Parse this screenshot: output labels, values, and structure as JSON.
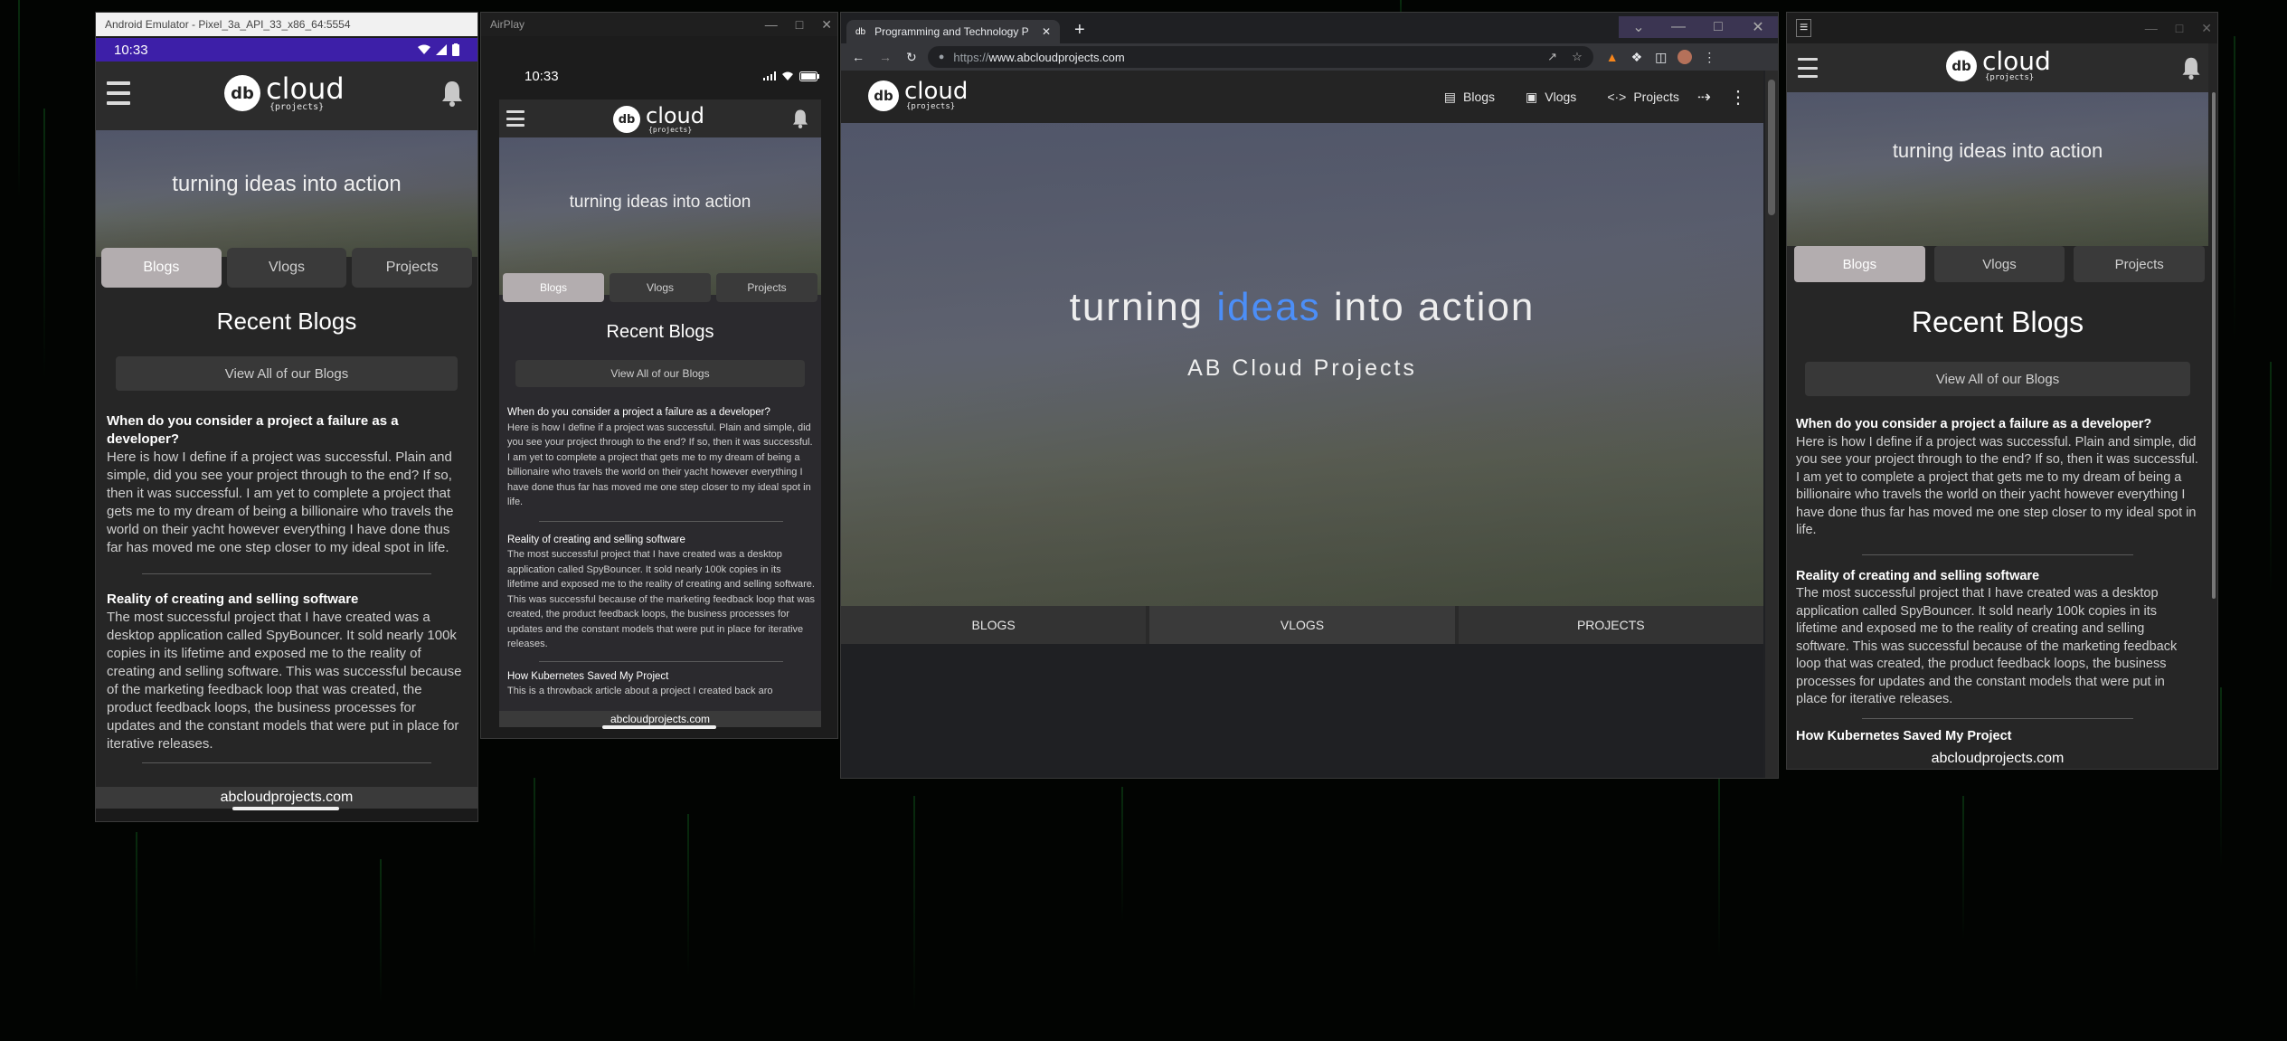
{
  "emulator": {
    "title": "Android Emulator - Pixel_3a_API_33_x86_64:5554",
    "time": "10:33"
  },
  "airplay": {
    "title": "AirPlay",
    "time": "10:33"
  },
  "browser": {
    "tab_title": "Programming and Technology P",
    "url_prefix": "https://",
    "url_host": "www.abcloudprojects.com",
    "nav": {
      "blogs": "Blogs",
      "vlogs": "Vlogs",
      "projects": "Projects"
    },
    "hero_word1": "turning",
    "hero_word2": "ideas",
    "hero_word3": "into action",
    "hero_sub": "AB Cloud Projects",
    "bottom_tabs": {
      "blogs": "BLOGS",
      "vlogs": "VLOGS",
      "projects": "PROJECTS"
    },
    "accent": "#4c8ef7"
  },
  "site": {
    "logo_badge": "db",
    "logo_big": "cloud",
    "logo_small": "{projects}",
    "tagline": "turning ideas into action",
    "tabs": {
      "blogs": "Blogs",
      "vlogs": "Vlogs",
      "projects": "Projects"
    },
    "section_title": "Recent Blogs",
    "view_all": "View All of our Blogs",
    "footer": "abcloudprojects.com",
    "posts": [
      {
        "title": "When do you consider a project a failure as a developer?",
        "body": "Here is how I define if a project was successful. Plain and simple, did you see your project through to the end?  If so, then it was successful.  I am yet to complete a project that gets me to my dream of being a billionaire who travels the world on their yacht however everything I have done thus far has moved me one step closer to my ideal spot in life."
      },
      {
        "title": "Reality of creating and selling software",
        "body": "The most successful project that I have created was a desktop application called SpyBouncer.  It sold nearly 100k copies in its lifetime and exposed me to the reality of creating and selling software.   This was successful because of the marketing feedback loop that was created, the product feedback loops, the business processes for updates and the constant models that were put in place for iterative releases."
      },
      {
        "title": "How Kubernetes Saved My Project",
        "body": "This is a throwback article about a project I created back aro"
      }
    ]
  }
}
